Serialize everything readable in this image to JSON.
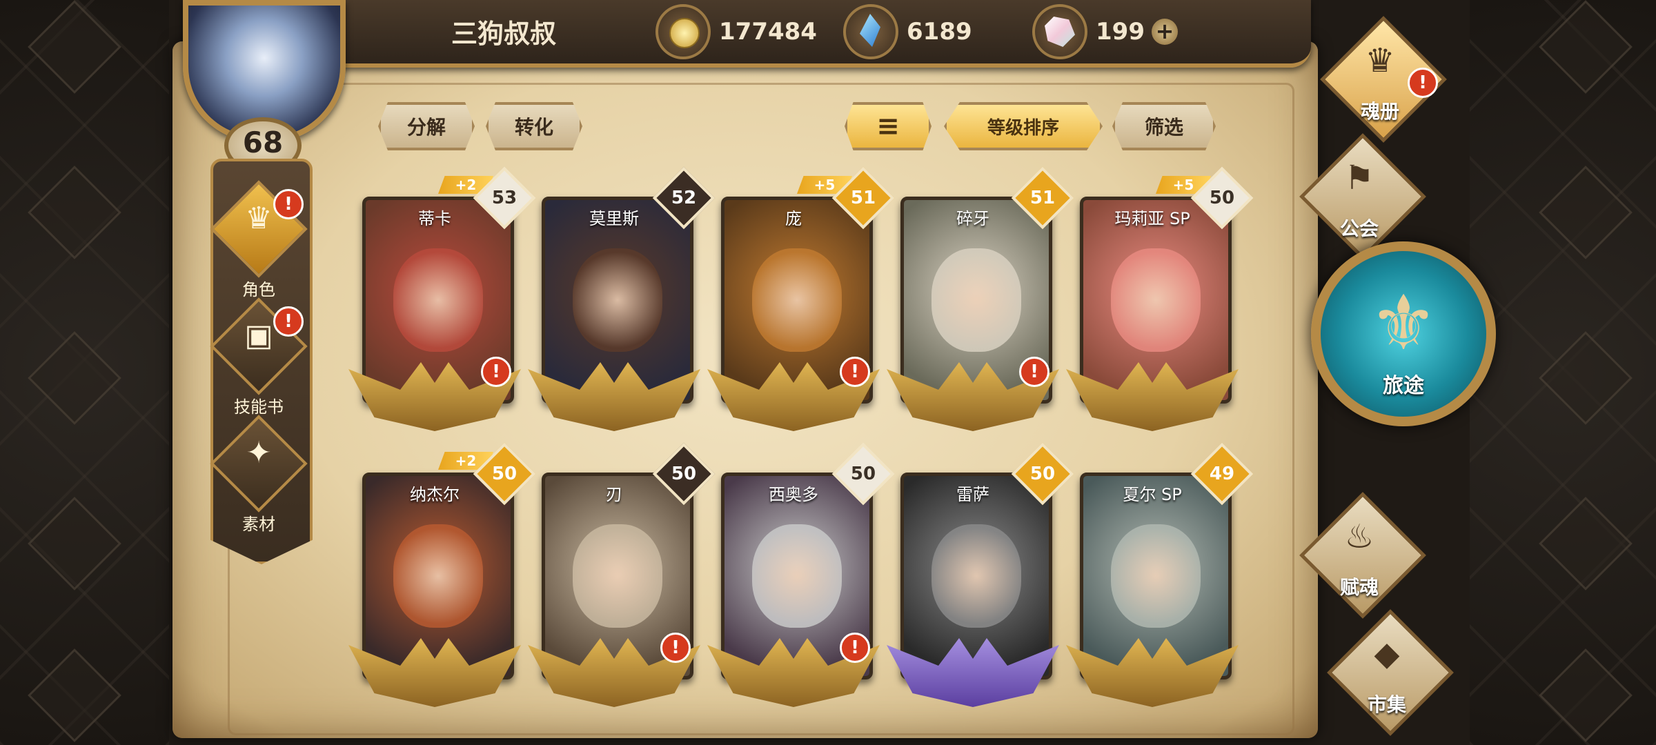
{
  "player": {
    "name": "三狗叔叔",
    "level": "68"
  },
  "resources": [
    {
      "icon": "gold-coin-icon",
      "value": "177484"
    },
    {
      "icon": "blue-crystal-icon",
      "value": "6189"
    },
    {
      "icon": "prism-gem-icon",
      "value": "199",
      "add": "+"
    }
  ],
  "left_nav": [
    {
      "label": "角色",
      "icon": "character-crest-icon",
      "alert": "!"
    },
    {
      "label": "技能书",
      "icon": "skill-book-icon",
      "alert": "!"
    },
    {
      "label": "素材",
      "icon": "materials-icon"
    }
  ],
  "actions": {
    "decompose": "分解",
    "convert": "转化",
    "sort_by_level": "等级排序",
    "filter": "筛选"
  },
  "heroes": [
    {
      "name": "蒂卡",
      "level": "53",
      "plus": "+2",
      "level_style": "grey",
      "alert": "!"
    },
    {
      "name": "莫里斯",
      "level": "52",
      "level_style": "dark"
    },
    {
      "name": "庞",
      "level": "51",
      "plus": "+5",
      "level_style": "gold",
      "alert": "!"
    },
    {
      "name": "碎牙",
      "level": "51",
      "level_style": "gold",
      "alert": "!"
    },
    {
      "name": "玛莉亚 SP",
      "level": "50",
      "plus": "+5",
      "level_style": "grey"
    },
    {
      "name": "纳杰尔",
      "level": "50",
      "plus": "+2",
      "level_style": "gold"
    },
    {
      "name": "刃",
      "level": "50",
      "level_style": "dark",
      "alert": "!"
    },
    {
      "name": "西奥多",
      "level": "50",
      "level_style": "grey",
      "alert": "!"
    },
    {
      "name": "雷萨",
      "level": "50",
      "level_style": "gold",
      "wings": "purple"
    },
    {
      "name": "夏尔 SP",
      "level": "49",
      "level_style": "gold"
    }
  ],
  "right_nav": {
    "soul_book": "魂册",
    "guild": "公会",
    "journey": "旅途",
    "endow_soul": "赋魂",
    "market": "市集",
    "alert": "!"
  },
  "colors": {
    "accent": "#b58a46",
    "alert": "#d63a1e",
    "gold": "#e8a51e",
    "teal": "#1a8a9c"
  }
}
